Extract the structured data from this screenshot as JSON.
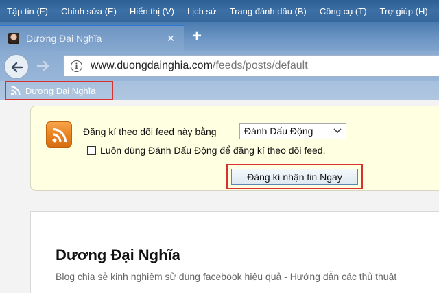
{
  "menubar": {
    "items": [
      {
        "label": "Tập tin (F)"
      },
      {
        "label": "Chỉnh sửa (E)"
      },
      {
        "label": "Hiển thị (V)"
      },
      {
        "label": "Lịch sử"
      },
      {
        "label": "Trang đánh dấu (B)"
      },
      {
        "label": "Công cụ (T)"
      },
      {
        "label": "Trợ giúp (H)"
      }
    ]
  },
  "tabs": {
    "active": {
      "title": "Dương Đại Nghĩa",
      "close": "×"
    },
    "new_tab": "+"
  },
  "navbar": {
    "url_domain": "www.duongdainghia.com",
    "url_path": "/feeds/posts/default"
  },
  "bookmarks": {
    "items": [
      {
        "label": "Dương Đại Nghĩa",
        "icon": "rss-icon"
      }
    ]
  },
  "feed_subscribe": {
    "prompt": "Đăng kí theo dõi feed này bằng",
    "reader_selected": "Đánh Dấu Động",
    "always_use_label": "Luôn dùng Đánh Dấu Động để đăng kí theo dõi feed.",
    "always_use_checked": false,
    "subscribe_button": "Đăng kí nhận tin Ngay"
  },
  "feed": {
    "title": "Dương Đại Nghĩa",
    "subtitle": "Blog chia sẻ kinh nghiệm sử dụng facebook hiệu quả - Hướng dẫn các thủ thuật"
  },
  "colors": {
    "menubar": "#35679c",
    "highlight_border": "#d9322e",
    "feed_panel_bg": "#ffffe1",
    "rss_orange": "#e8821f"
  }
}
